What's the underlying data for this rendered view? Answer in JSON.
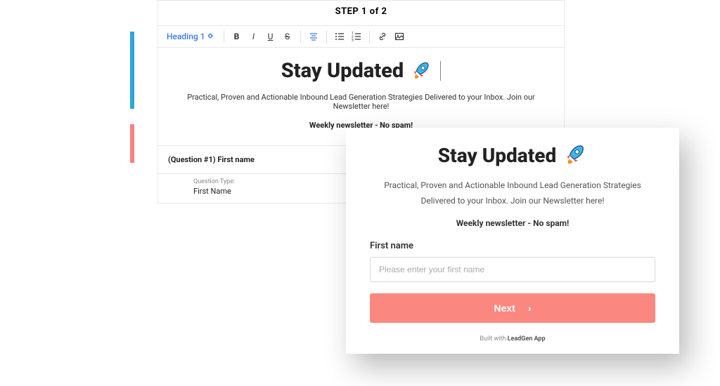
{
  "editor": {
    "step_header": "STEP 1 of 2",
    "toolbar": {
      "heading_select_label": "Heading 1"
    },
    "title": "Stay Updated",
    "subtitle": "Practical, Proven and Actionable Inbound Lead Generation Strategies Delivered to your Inbox. Join our Newsletter here!",
    "note": "Weekly newsletter - No spam!",
    "question": {
      "header": "(Question #1) First name",
      "type_label": "Question Type:",
      "type_value": "First Name"
    }
  },
  "preview": {
    "title": "Stay Updated",
    "subtitle": "Practical, Proven and Actionable Inbound Lead Generation Strategies Delivered to your Inbox. Join our Newsletter here!",
    "note": "Weekly newsletter - No spam!",
    "form": {
      "label": "First name",
      "placeholder": "Please enter your first name"
    },
    "next_label": "Next",
    "built_with_prefix": "Built with ",
    "built_with_brand": "LeadGen App"
  },
  "colors": {
    "accent_blue": "#2ca5dc",
    "accent_coral": "#f58280",
    "button_coral": "#fa8880"
  }
}
